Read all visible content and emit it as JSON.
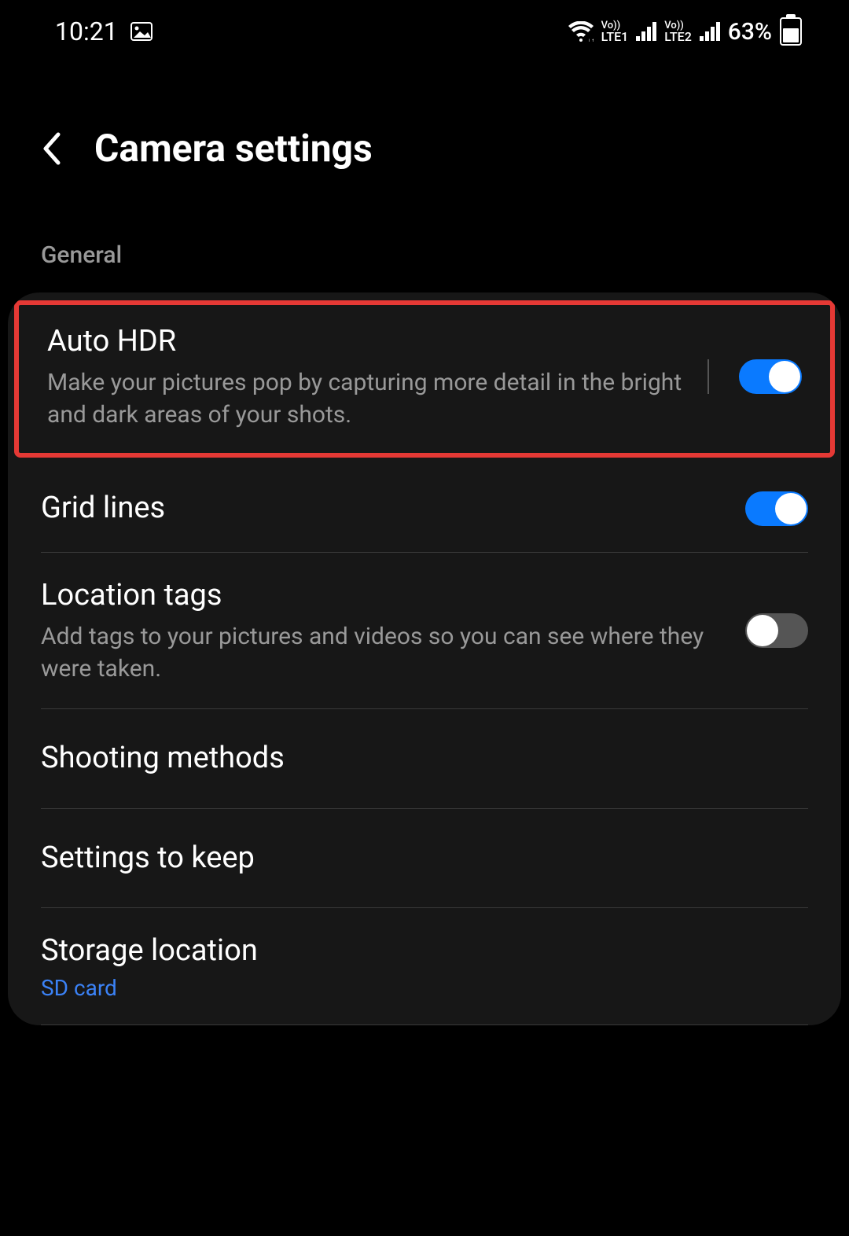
{
  "status_bar": {
    "time": "10:21",
    "lte1": "LTE1",
    "lte2": "LTE2",
    "vo1": "Vo))",
    "vo2": "Vo))",
    "battery_percent": "63%"
  },
  "header": {
    "title": "Camera settings"
  },
  "section": {
    "label": "General"
  },
  "items": {
    "auto_hdr": {
      "title": "Auto HDR",
      "description": "Make your pictures pop by capturing more detail in the bright and dark areas of your shots.",
      "toggle": true
    },
    "grid_lines": {
      "title": "Grid lines",
      "toggle": true
    },
    "location_tags": {
      "title": "Location tags",
      "description": "Add tags to your pictures and videos so you can see where they were taken.",
      "toggle": false
    },
    "shooting_methods": {
      "title": "Shooting methods"
    },
    "settings_to_keep": {
      "title": "Settings to keep"
    },
    "storage_location": {
      "title": "Storage location",
      "value": "SD card"
    }
  }
}
